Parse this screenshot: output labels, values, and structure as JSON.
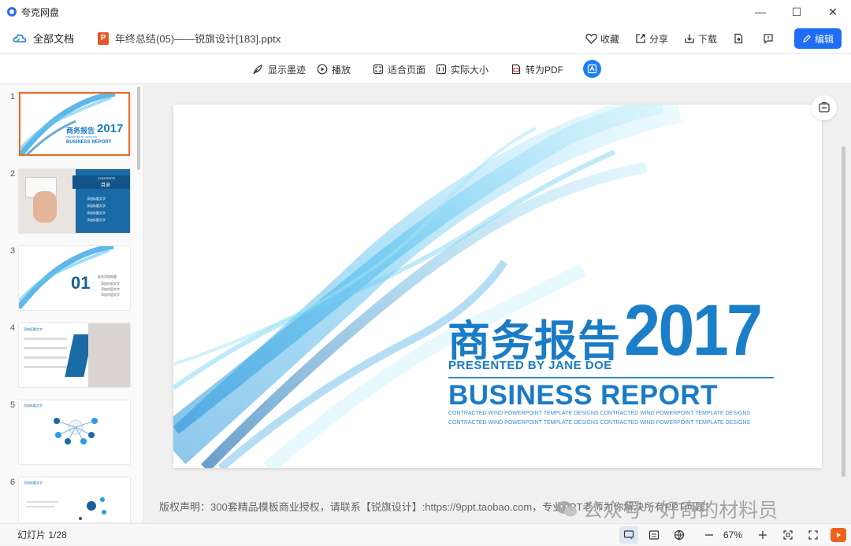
{
  "titlebar": {
    "app_name": "夸克网盘",
    "minimize": "—",
    "maximize": "☐",
    "close": "✕"
  },
  "docbar": {
    "all_docs": "全部文档",
    "file_badge": "P",
    "file_name": "年终总结(05)——锐旗设计[183].pptx",
    "favorite": "收藏",
    "share": "分享",
    "download": "下载",
    "edit": "编辑"
  },
  "viewbar": {
    "show_ink": "显示墨迹",
    "play": "播放",
    "fit_page": "适合页面",
    "actual_size": "实际大小",
    "to_pdf": "转为PDF"
  },
  "thumbnails": [
    {
      "num": "1",
      "title": "商务报告",
      "year": "2017",
      "sub": "BUSINESS REPORT",
      "label_small": "PRESENTED BY JANE DOE"
    },
    {
      "num": "2",
      "header": "CONTENTS",
      "title": "目录",
      "items": [
        "添加标题文字",
        "添加标题文字",
        "添加标题文字",
        "添加标题文字"
      ]
    },
    {
      "num": "3",
      "big": "01",
      "title": "此处添加标题",
      "items": [
        "添加内容文字",
        "添加内容文字",
        "添加内容文字"
      ]
    },
    {
      "num": "4",
      "title": "添加标题文字"
    },
    {
      "num": "5",
      "title": "添加标题文字"
    },
    {
      "num": "6",
      "title": "添加标题文字"
    }
  ],
  "slide": {
    "title_cn": "商务报告",
    "year": "2017",
    "presented": "PRESENTED BY JANE DOE",
    "business": "BUSINESS REPORT",
    "small": "CONTRACTED WIND POWERPOINT TEMPLATE DESIGNS CONTRACTED WIND POWERPOINT TEMPLATE DESIGNS CONTRACTED WIND POWERPOINT TEMPLATE DESIGNS CONTRACTED WIND POWERPOINT TEMPLATE DESIGNS"
  },
  "notes": "版权声明：300套精品模板商业授权，请联系【锐旗设计】:https://9ppt.taobao.com，专业PPT老师为你解决所有PPT问题！",
  "watermark": "公众号 · 好奇的材料员",
  "status": {
    "page": "幻灯片 1/28",
    "zoom": "67%"
  },
  "colors": {
    "accent": "#1f6cf5",
    "slide_blue": "#1a7bc6",
    "ppt_orange": "#e5582a",
    "selected_border": "#e96a2c"
  }
}
